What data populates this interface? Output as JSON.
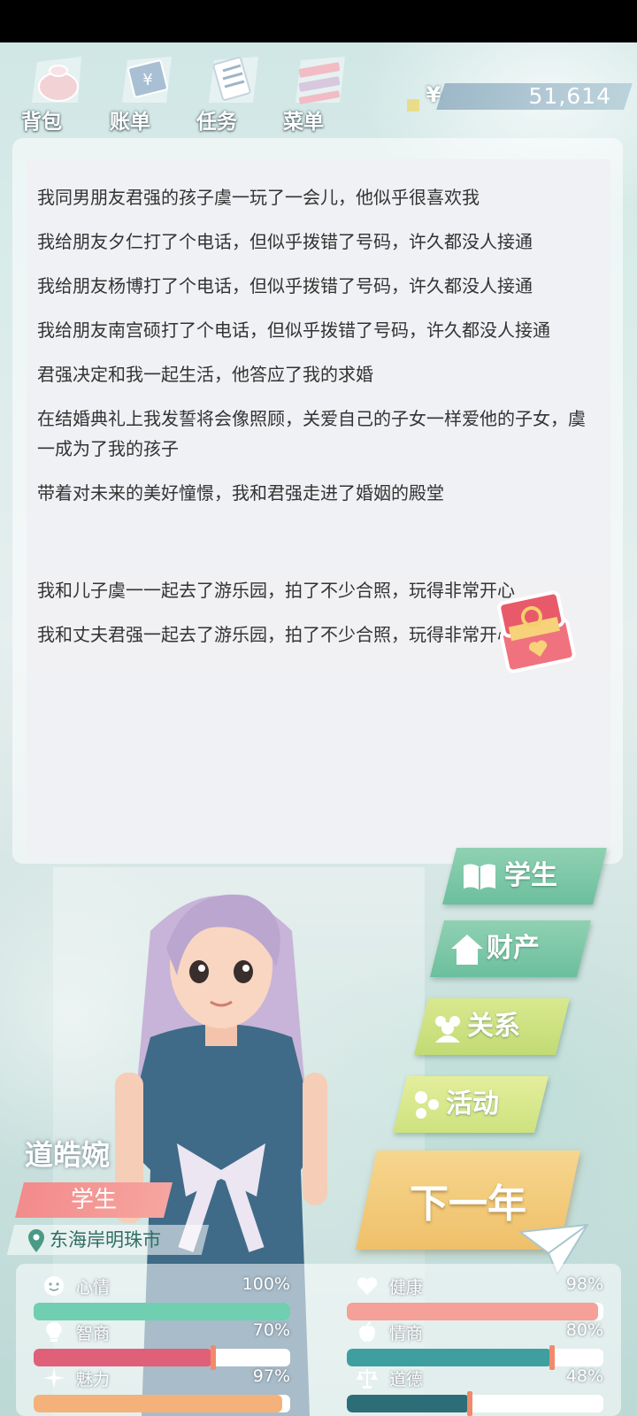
{
  "toolbar": {
    "items": [
      {
        "label": "背包",
        "icon": "backpack-icon"
      },
      {
        "label": "账单",
        "icon": "bill-icon"
      },
      {
        "label": "任务",
        "icon": "task-icon"
      },
      {
        "label": "菜单",
        "icon": "menu-icon"
      }
    ]
  },
  "money": {
    "symbol": "¥",
    "value": "51,614"
  },
  "log": [
    "我同男朋友君强的孩子虞一玩了一会儿，他似乎很喜欢我",
    "我给朋友夕仁打了个电话，但似乎拨错了号码，许久都没人接通",
    "我给朋友杨博打了个电话，但似乎拨错了号码，许久都没人接通",
    "我给朋友南宫硕打了个电话，但似乎拨错了号码，许久都没人接通",
    "君强决定和我一起生活，他答应了我的求婚",
    "在结婚典礼上我发誓将会像照顾，关爱自己的子女一样爱他的子女，虞一成为了我的孩子",
    "带着对未来的美好憧憬，我和君强走进了婚姻的殿堂",
    "我和儿子虞一一起去了游乐园，拍了不少合照，玩得非常开心",
    "我和丈夫君强一起去了游乐园，拍了不少合照，玩得非常开心"
  ],
  "side_menu": {
    "student": "学生",
    "property": "财产",
    "relations": "关系",
    "activity": "活动",
    "next_year": "下一年"
  },
  "character": {
    "name": "道皓婉",
    "role": "学生",
    "location": "东海岸明珠市"
  },
  "stats": {
    "mood": {
      "label": "心情",
      "value": "100%",
      "level": 1.0,
      "color": "#6fcfb0"
    },
    "iq": {
      "label": "智商",
      "value": "70%",
      "level": 0.7,
      "color": "#e0607a"
    },
    "charm": {
      "label": "魅力",
      "value": "97%",
      "level": 0.97,
      "color": "#f4b27a"
    },
    "health": {
      "label": "健康",
      "value": "98%",
      "level": 0.98,
      "color": "#f5a098"
    },
    "emotion": {
      "label": "情商",
      "value": "80%",
      "level": 0.8,
      "color": "#3f9ea0"
    },
    "morality": {
      "label": "道德",
      "value": "48%",
      "level": 0.48,
      "color": "#2c6d78"
    }
  }
}
